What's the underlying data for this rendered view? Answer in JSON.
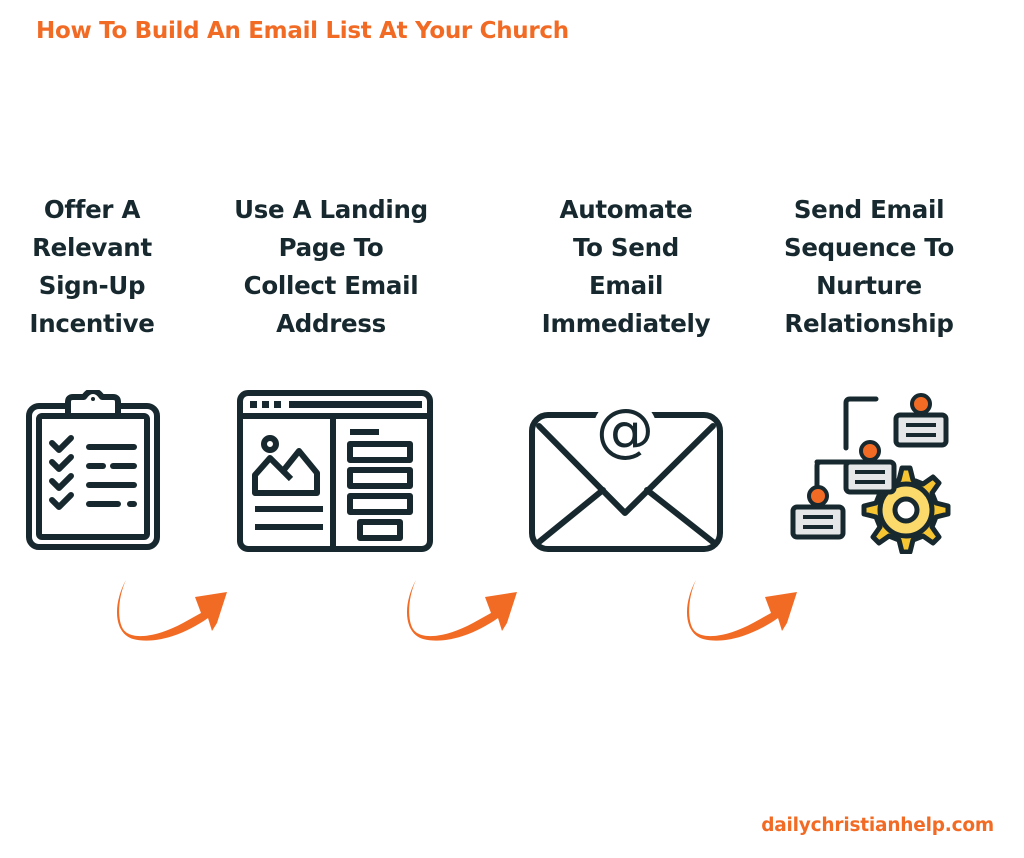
{
  "title": "How To Build An Email List At Your Church",
  "steps": [
    {
      "lines": [
        "Offer A",
        "Relevant",
        "Sign-Up",
        "Incentive"
      ],
      "icon": "clipboard-checklist-icon"
    },
    {
      "lines": [
        "Use A Landing",
        "Page To",
        "Collect Email",
        "Address"
      ],
      "icon": "landing-page-icon"
    },
    {
      "lines": [
        "Automate",
        "To Send",
        "Email",
        "Immediately"
      ],
      "icon": "email-envelope-icon"
    },
    {
      "lines": [
        "Send Email",
        "Sequence To",
        "Nurture",
        "Relationship"
      ],
      "icon": "workflow-gear-icon"
    }
  ],
  "footer": "dailychristianhelp.com",
  "colors": {
    "accent": "#f26b25",
    "text": "#17292e",
    "gear": "#f7c531",
    "gear_inner": "#fbd96a",
    "card": "#e4e6e8"
  }
}
